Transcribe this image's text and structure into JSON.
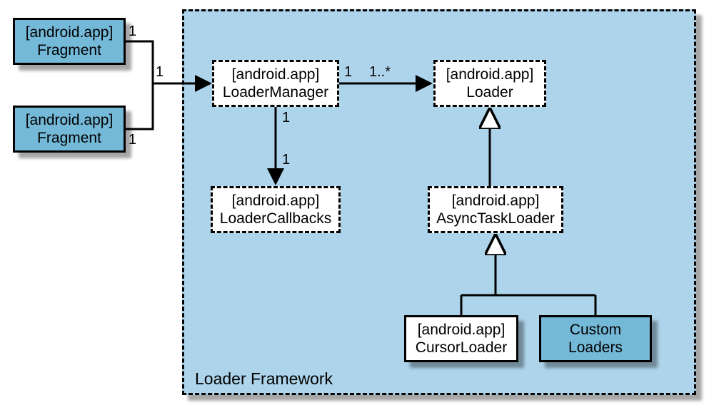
{
  "framework": {
    "label": "Loader Framework"
  },
  "boxes": {
    "fragment1": {
      "pkg": "[android.app]",
      "name": "Fragment"
    },
    "fragment2": {
      "pkg": "[android.app]",
      "name": "Fragment"
    },
    "loaderManager": {
      "pkg": "[android.app]",
      "name": "LoaderManager"
    },
    "loader": {
      "pkg": "[android.app]",
      "name": "Loader"
    },
    "loaderCallbacks": {
      "pkg": "[android.app]",
      "name": "LoaderCallbacks"
    },
    "asyncTaskLoader": {
      "pkg": "[android.app]",
      "name": "AsyncTaskLoader"
    },
    "cursorLoader": {
      "pkg": "[android.app]",
      "name": "CursorLoader"
    },
    "customLoaders": {
      "name1": "Custom",
      "name2": "Loaders"
    }
  },
  "mult": {
    "frag1_to_join": "1",
    "frag2_to_join": "1",
    "join_to_lm": "1",
    "lm_to_loader_src": "1",
    "lm_to_loader_dst": "1..*",
    "lm_to_cb_src": "1",
    "lm_to_cb_dst": "1"
  },
  "colors": {
    "frameworkFill": "#add4ea",
    "solidBoxFill": "#74b9d8",
    "line": "#000000"
  }
}
